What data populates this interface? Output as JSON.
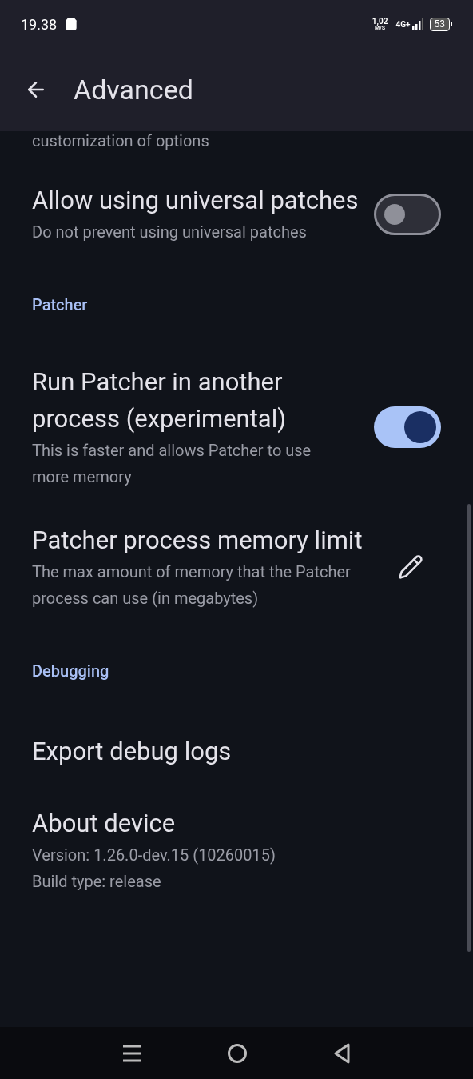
{
  "status_bar": {
    "time": "19.38",
    "speed": "1,02",
    "speed_unit": "M/S",
    "network": "4G+",
    "battery": "53"
  },
  "top_bar": {
    "title": "Advanced"
  },
  "items": [
    {
      "kind": "cut",
      "subtitle": "customization of options"
    },
    {
      "kind": "switch",
      "title": "Allow using universal patches",
      "subtitle": "Do not prevent using universal patches",
      "on": false
    },
    {
      "kind": "header",
      "title": "Patcher"
    },
    {
      "kind": "switch",
      "title": "Run Patcher in another process (experimental)",
      "subtitle": "This is faster and allows Patcher to use more memory",
      "on": true
    },
    {
      "kind": "edit",
      "title": "Patcher process memory limit",
      "subtitle": "The max amount of memory that the Patcher process can use (in megabytes)"
    },
    {
      "kind": "header",
      "title": "Debugging"
    },
    {
      "kind": "plain",
      "title": "Export debug logs"
    },
    {
      "kind": "plain",
      "title": "About device",
      "lines": [
        "Version: 1.26.0-dev.15 (10260015)",
        "Build type: release"
      ]
    }
  ]
}
